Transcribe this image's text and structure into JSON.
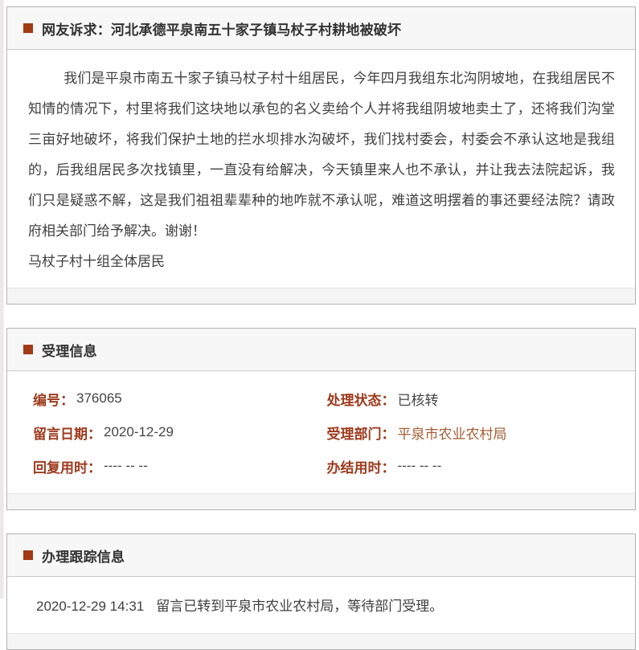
{
  "complaint": {
    "title": "网友诉求：河北承德平泉南五十家子镇马杖子村耕地被破坏",
    "body": "我们是平泉市南五十家子镇马杖子村十组居民，今年四月我组东北沟阴坡地，在我组居民不知情的情况下，村里将我们这块地以承包的名义卖给个人并将我组阴坡地卖土了，还将我们沟堂三亩好地破坏，将我们保护土地的拦水坝排水沟破坏，我们找村委会，村委会不承认这地是我组的，后我组居民多次找镇里，一直没有给解决，今天镇里来人也不承认，并让我去法院起诉，我们只是疑惑不解，这是我们祖祖辈辈种的地咋就不承认呢，难道这明摆着的事还要经法院？请政府相关部门给予解决。谢谢！",
    "signature": "马杖子村十组全体居民"
  },
  "acceptance": {
    "title": "受理信息",
    "fields": [
      {
        "label": "编号：",
        "value": "376065"
      },
      {
        "label": "处理状态：",
        "value": "已核转"
      },
      {
        "label": "留言日期：",
        "value": "2020-12-29"
      },
      {
        "label": "受理部门：",
        "value": "平泉市农业农村局"
      },
      {
        "label": "回复用时：",
        "value": "---- -- --"
      },
      {
        "label": "办结用时：",
        "value": "---- -- --"
      }
    ]
  },
  "tracking": {
    "title": "办理跟踪信息",
    "timestamp": "2020-12-29 14:31",
    "message": "留言已转到平泉市农业农村局，等待部门受理。"
  },
  "colors": {
    "accent_bullet": "#a23a16",
    "field_label": "#9e3a1d",
    "department_value": "#a45c33",
    "header_band_bg": "#f7f7f7",
    "box_border": "#b3b3b3",
    "body_text": "#3f3f3f"
  }
}
